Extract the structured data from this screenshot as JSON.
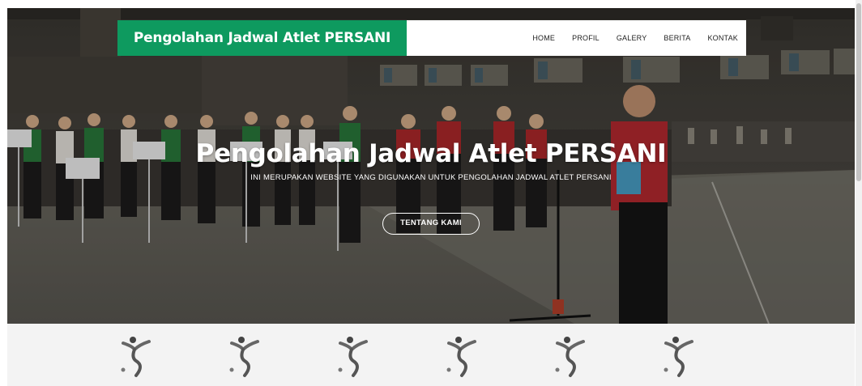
{
  "navbar": {
    "brand": "Pengolahan Jadwal Atlet PERSANI",
    "menu": [
      "HOME",
      "PROFIL",
      "GALERY",
      "BERITA",
      "KONTAK"
    ]
  },
  "hero": {
    "title": "Pengolahan Jadwal Atlet PERSANI",
    "subtitle": "INI MERUPAKAN WEBSITE YANG DIGUNAKAN UNTUK PENGOLAHAN JADWAL ATLET PERSANI",
    "button": "TENTANG KAMI"
  },
  "logo_strip": {
    "icon": "gymnast-icon",
    "count": 6
  },
  "colors": {
    "brand": "#0e9a5f",
    "nav_bg": "#ffffff",
    "text_light": "#ffffff"
  }
}
